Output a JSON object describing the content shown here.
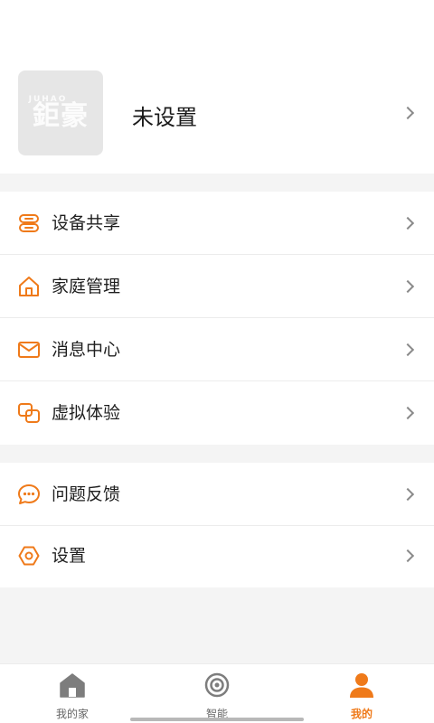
{
  "colors": {
    "accent": "#ef7a1a",
    "tab_inactive": "#7d7d7d"
  },
  "profile": {
    "logo_small": "JUHAO",
    "logo_big": "鉅豪",
    "name": "未设置"
  },
  "menu_group1": [
    {
      "label": "设备共享",
      "icon": "device-share-icon"
    },
    {
      "label": "家庭管理",
      "icon": "home-icon"
    },
    {
      "label": "消息中心",
      "icon": "mail-icon"
    },
    {
      "label": "虚拟体验",
      "icon": "virtual-experience-icon"
    }
  ],
  "menu_group2": [
    {
      "label": "问题反馈",
      "icon": "chat-bubble-icon"
    },
    {
      "label": "设置",
      "icon": "hexagon-settings-icon"
    }
  ],
  "tabs": [
    {
      "label": "我的家",
      "icon": "home-tab-icon",
      "active": false
    },
    {
      "label": "智能",
      "icon": "smart-target-icon",
      "active": false
    },
    {
      "label": "我的",
      "icon": "person-icon",
      "active": true
    }
  ]
}
